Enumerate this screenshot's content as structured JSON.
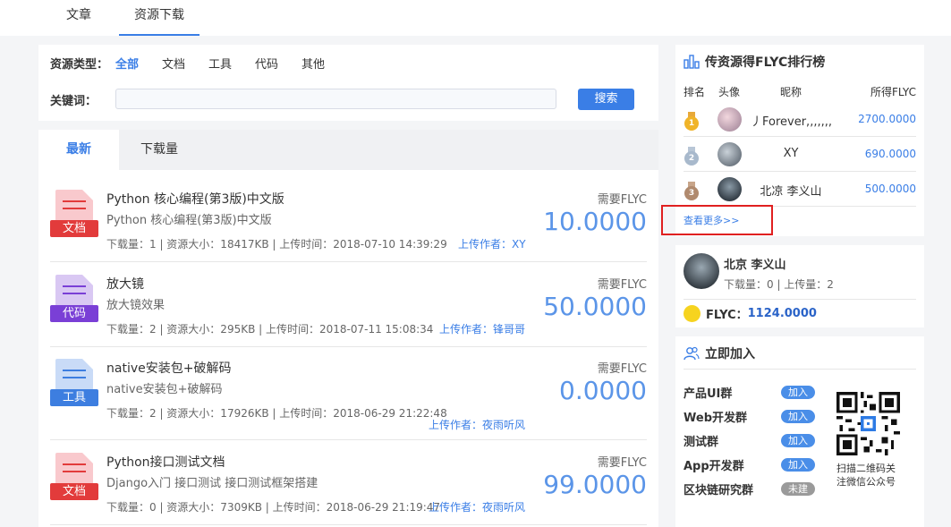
{
  "topnav": {
    "tabs": [
      "文章",
      "资源下载"
    ],
    "active": "资源下载"
  },
  "filter": {
    "type_label": "资源类型：",
    "types": [
      "全部",
      "文档",
      "工具",
      "代码",
      "其他"
    ],
    "active_type": "全部",
    "keyword_label": "关键词：",
    "keyword_value": "",
    "search_label": "搜索"
  },
  "list": {
    "tabs": [
      "最新",
      "下载量"
    ],
    "active_tab": "最新",
    "items": [
      {
        "tag": "文档",
        "title": "Python 核心编程(第3版)中文版",
        "desc": "Python 核心编程(第3版)中文版",
        "meta": "下载量：1 | 资源大小：18417KB | 上传时间：2018-07-10 14:39:29",
        "author": "上传作者：XY",
        "need": "需要FLYC",
        "price": "10.0000"
      },
      {
        "tag": "代码",
        "title": "放大镜",
        "desc": "放大镜效果",
        "meta": "下载量：2 | 资源大小：295KB | 上传时间：2018-07-11 15:08:34",
        "author": "上传作者：锋哥哥",
        "need": "需要FLYC",
        "price": "50.0000"
      },
      {
        "tag": "工具",
        "title": "native安装包+破解码",
        "desc": "native安装包+破解码",
        "meta": "下载量：2 | 资源大小：17926KB | 上传时间：2018-06-29 21:22:48",
        "author": "上传作者：夜雨听风",
        "need": "需要FLYC",
        "price": "0.0000"
      },
      {
        "tag": "文档",
        "title": "Python接口测试文档",
        "desc": "Django入门 接口测试 接口测试框架搭建",
        "meta": "下载量：0 | 资源大小：7309KB | 上传时间：2018-06-29 21:19:47",
        "author": "上传作者：夜雨听风",
        "need": "需要FLYC",
        "price": "99.0000"
      }
    ]
  },
  "rank": {
    "title": "传资源得FLYC排行榜",
    "cols": [
      "排名",
      "头像",
      "昵称",
      "所得FLYC"
    ],
    "rows": [
      {
        "pos": "1",
        "nick": "丿Forever,,,,,,,",
        "pts": "2700.0000"
      },
      {
        "pos": "2",
        "nick": "XY",
        "pts": "690.0000"
      },
      {
        "pos": "3",
        "nick": "北凉 李义山",
        "pts": "500.0000"
      }
    ],
    "more": "查看更多>>"
  },
  "user": {
    "name": "北京 李义山",
    "stats": "下载量：0 | 上传量：2",
    "flyc_label": "FLYC：",
    "flyc_value": "1124.0000"
  },
  "join": {
    "title": "立即加入",
    "groups": [
      {
        "name": "产品UI群",
        "btn": "加入"
      },
      {
        "name": "Web开发群",
        "btn": "加入"
      },
      {
        "name": "测试群",
        "btn": "加入"
      },
      {
        "name": "App开发群",
        "btn": "加入"
      },
      {
        "name": "区块链研究群",
        "btn": "未建"
      }
    ],
    "qr_text": "扫描二维码关注微信公众号"
  },
  "colors": {
    "accent": "#3a7ee6",
    "doc": "#e23b3b",
    "code": "#7a3fd6",
    "tool": "#3d7ee0",
    "join_btn": "#4a8ee8",
    "not_built_btn": "#9a9a9a",
    "highlight_box": "#e02020"
  }
}
